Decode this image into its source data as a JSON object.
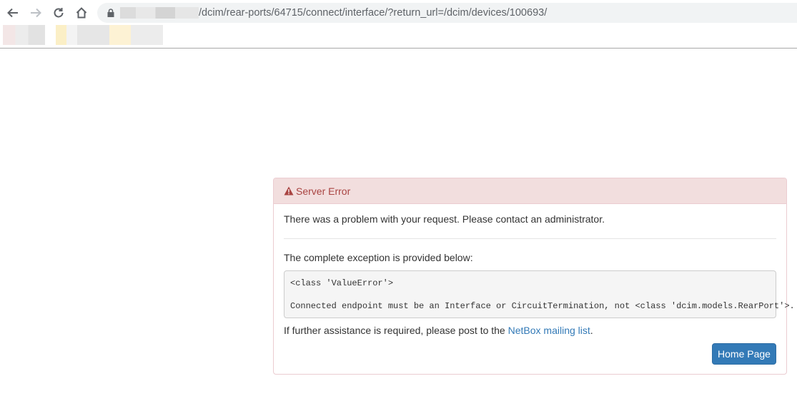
{
  "browser": {
    "url_path": "/dcim/rear-ports/64715/connect/interface/?return_url=/dcim/devices/100693/"
  },
  "error": {
    "title": "Server Error",
    "message": "There was a problem with your request. Please contact an administrator.",
    "exception_intro": "The complete exception is provided below:",
    "exception_class": "<class 'ValueError'>",
    "exception_message": "Connected endpoint must be an Interface or CircuitTermination, not <class 'dcim.models.RearPort'>.",
    "assistance_text": "If further assistance is required, please post to the ",
    "mailing_list_link": "NetBox mailing list",
    "assistance_suffix": ".",
    "home_button": "Home Page"
  },
  "colors": {
    "danger_text": "#a94442",
    "danger_bg": "#f2dede",
    "primary": "#337ab7"
  }
}
